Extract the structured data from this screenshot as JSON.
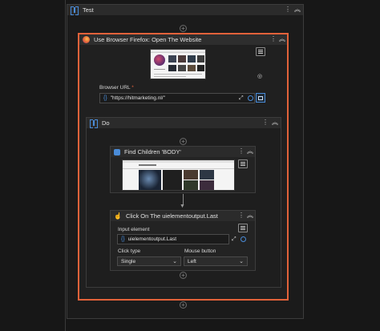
{
  "sequence": {
    "title": "Test"
  },
  "browser_activity": {
    "title": "Use Browser Firefox: Open The Website",
    "url_label": "Browser URL",
    "required_marker": "*",
    "url_value": "\"https://hitmarketing.nl/\""
  },
  "do_sequence": {
    "title": "Do"
  },
  "find_children": {
    "title": "Find Children 'BODY'"
  },
  "click_activity": {
    "title": "Click On The uielementoutput.Last",
    "input_element_label": "Input element",
    "input_element_value": "uielementoutput.Last",
    "click_type_label": "Click type",
    "click_type_value": "Single",
    "mouse_button_label": "Mouse button",
    "mouse_button_value": "Left"
  },
  "colors": {
    "selected_outline": "#e2623a",
    "accent_blue": "#4a8cd8",
    "background": "#171717"
  },
  "icons": {
    "sequence": "sequence-icon",
    "more": "more-vertical-icon",
    "collapse": "collapse-up-icon",
    "browser": "firefox-icon",
    "find": "find-children-icon",
    "click": "click-icon",
    "add": "add-activity-icon",
    "menu": "hamburger-menu-icon"
  }
}
